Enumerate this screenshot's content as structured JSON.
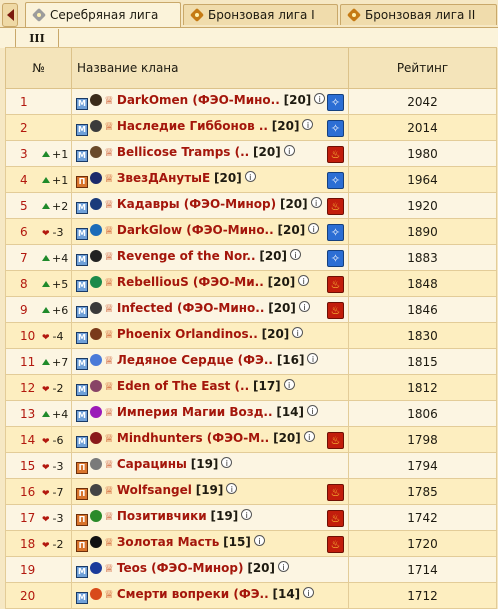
{
  "tabs": [
    {
      "label": "Серебряная лига",
      "active": true
    },
    {
      "label": "Бронзовая лига I",
      "active": false
    },
    {
      "label": "Бронзовая лига II",
      "active": false
    }
  ],
  "subtab": "III",
  "headers": {
    "rank": "№",
    "name": "Название клана",
    "rating": "Рейтинг"
  },
  "rows": [
    {
      "pos": "1",
      "change": "",
      "dir": "",
      "faction": "M",
      "clan": "DarkOmen (ФЭО-Мино..",
      "lvl": "[20]",
      "element": "light",
      "rating": "2042"
    },
    {
      "pos": "2",
      "change": "",
      "dir": "",
      "faction": "M",
      "clan": "Наследие Гиббонов ..",
      "lvl": "[20]",
      "element": "light",
      "rating": "2014"
    },
    {
      "pos": "3",
      "change": "+1",
      "dir": "up",
      "faction": "M",
      "clan": "Bellicose Tramps (..",
      "lvl": "[20]",
      "element": "fire",
      "rating": "1980"
    },
    {
      "pos": "4",
      "change": "+1",
      "dir": "up",
      "faction": "П",
      "clan": "ЗвезДАнутыЕ",
      "lvl": "[20]",
      "element": "light",
      "rating": "1964"
    },
    {
      "pos": "5",
      "change": "+2",
      "dir": "up",
      "faction": "M",
      "clan": "Кадавры (ФЭО-Минор)",
      "lvl": "[20]",
      "element": "fire",
      "rating": "1920"
    },
    {
      "pos": "6",
      "change": "-3",
      "dir": "down",
      "faction": "M",
      "clan": "DarkGlow (ФЭО-Мино..",
      "lvl": "[20]",
      "element": "light",
      "rating": "1890"
    },
    {
      "pos": "7",
      "change": "+4",
      "dir": "up",
      "faction": "M",
      "clan": "Revenge of the Nor..",
      "lvl": "[20]",
      "element": "light",
      "rating": "1883"
    },
    {
      "pos": "8",
      "change": "+5",
      "dir": "up",
      "faction": "M",
      "clan": "RebelliouS (ФЭО-Ми..",
      "lvl": "[20]",
      "element": "fire",
      "rating": "1848"
    },
    {
      "pos": "9",
      "change": "+6",
      "dir": "up",
      "faction": "M",
      "clan": "Infected (ФЭО-Мино..",
      "lvl": "[20]",
      "element": "fire",
      "rating": "1846"
    },
    {
      "pos": "10",
      "change": "-4",
      "dir": "down",
      "faction": "M",
      "clan": "Phoenix Orlandinos..",
      "lvl": "[20]",
      "element": "",
      "rating": "1830"
    },
    {
      "pos": "11",
      "change": "+7",
      "dir": "up",
      "faction": "M",
      "clan": "Ледяное Сердце (ФЭ..",
      "lvl": "[16]",
      "element": "",
      "rating": "1815"
    },
    {
      "pos": "12",
      "change": "-2",
      "dir": "down",
      "faction": "M",
      "clan": "Eden of The East (..",
      "lvl": "[17]",
      "element": "",
      "rating": "1812"
    },
    {
      "pos": "13",
      "change": "+4",
      "dir": "up",
      "faction": "M",
      "clan": "Империя Магии Возд..",
      "lvl": "[14]",
      "element": "",
      "rating": "1806"
    },
    {
      "pos": "14",
      "change": "-6",
      "dir": "down",
      "faction": "M",
      "clan": "Mindhunters (ФЭО-М..",
      "lvl": "[20]",
      "element": "fire",
      "rating": "1798"
    },
    {
      "pos": "15",
      "change": "-3",
      "dir": "down",
      "faction": "П",
      "clan": "Сарацины",
      "lvl": "[19]",
      "element": "",
      "rating": "1794"
    },
    {
      "pos": "16",
      "change": "-7",
      "dir": "down",
      "faction": "П",
      "clan": "Wolfsangel",
      "lvl": "[19]",
      "element": "fire",
      "rating": "1785"
    },
    {
      "pos": "17",
      "change": "-3",
      "dir": "down",
      "faction": "П",
      "clan": "Позитивчики",
      "lvl": "[19]",
      "element": "fire",
      "rating": "1742"
    },
    {
      "pos": "18",
      "change": "-2",
      "dir": "down",
      "faction": "П",
      "clan": "Золотая Масть",
      "lvl": "[15]",
      "element": "fire",
      "rating": "1720"
    },
    {
      "pos": "19",
      "change": "",
      "dir": "",
      "faction": "M",
      "clan": "Teos (ФЭО-Минор)",
      "lvl": "[20]",
      "element": "",
      "rating": "1714"
    },
    {
      "pos": "20",
      "change": "",
      "dir": "",
      "faction": "M",
      "clan": "Смерти вопреки (ФЭ..",
      "lvl": "[14]",
      "element": "",
      "rating": "1712"
    }
  ],
  "colors": {
    "clan_text": "#a4160b",
    "rank_text": "#b2180e",
    "up_arrow": "#1f8a2a",
    "light_element": "#2c6ed4",
    "fire_element": "#c21d0c"
  }
}
